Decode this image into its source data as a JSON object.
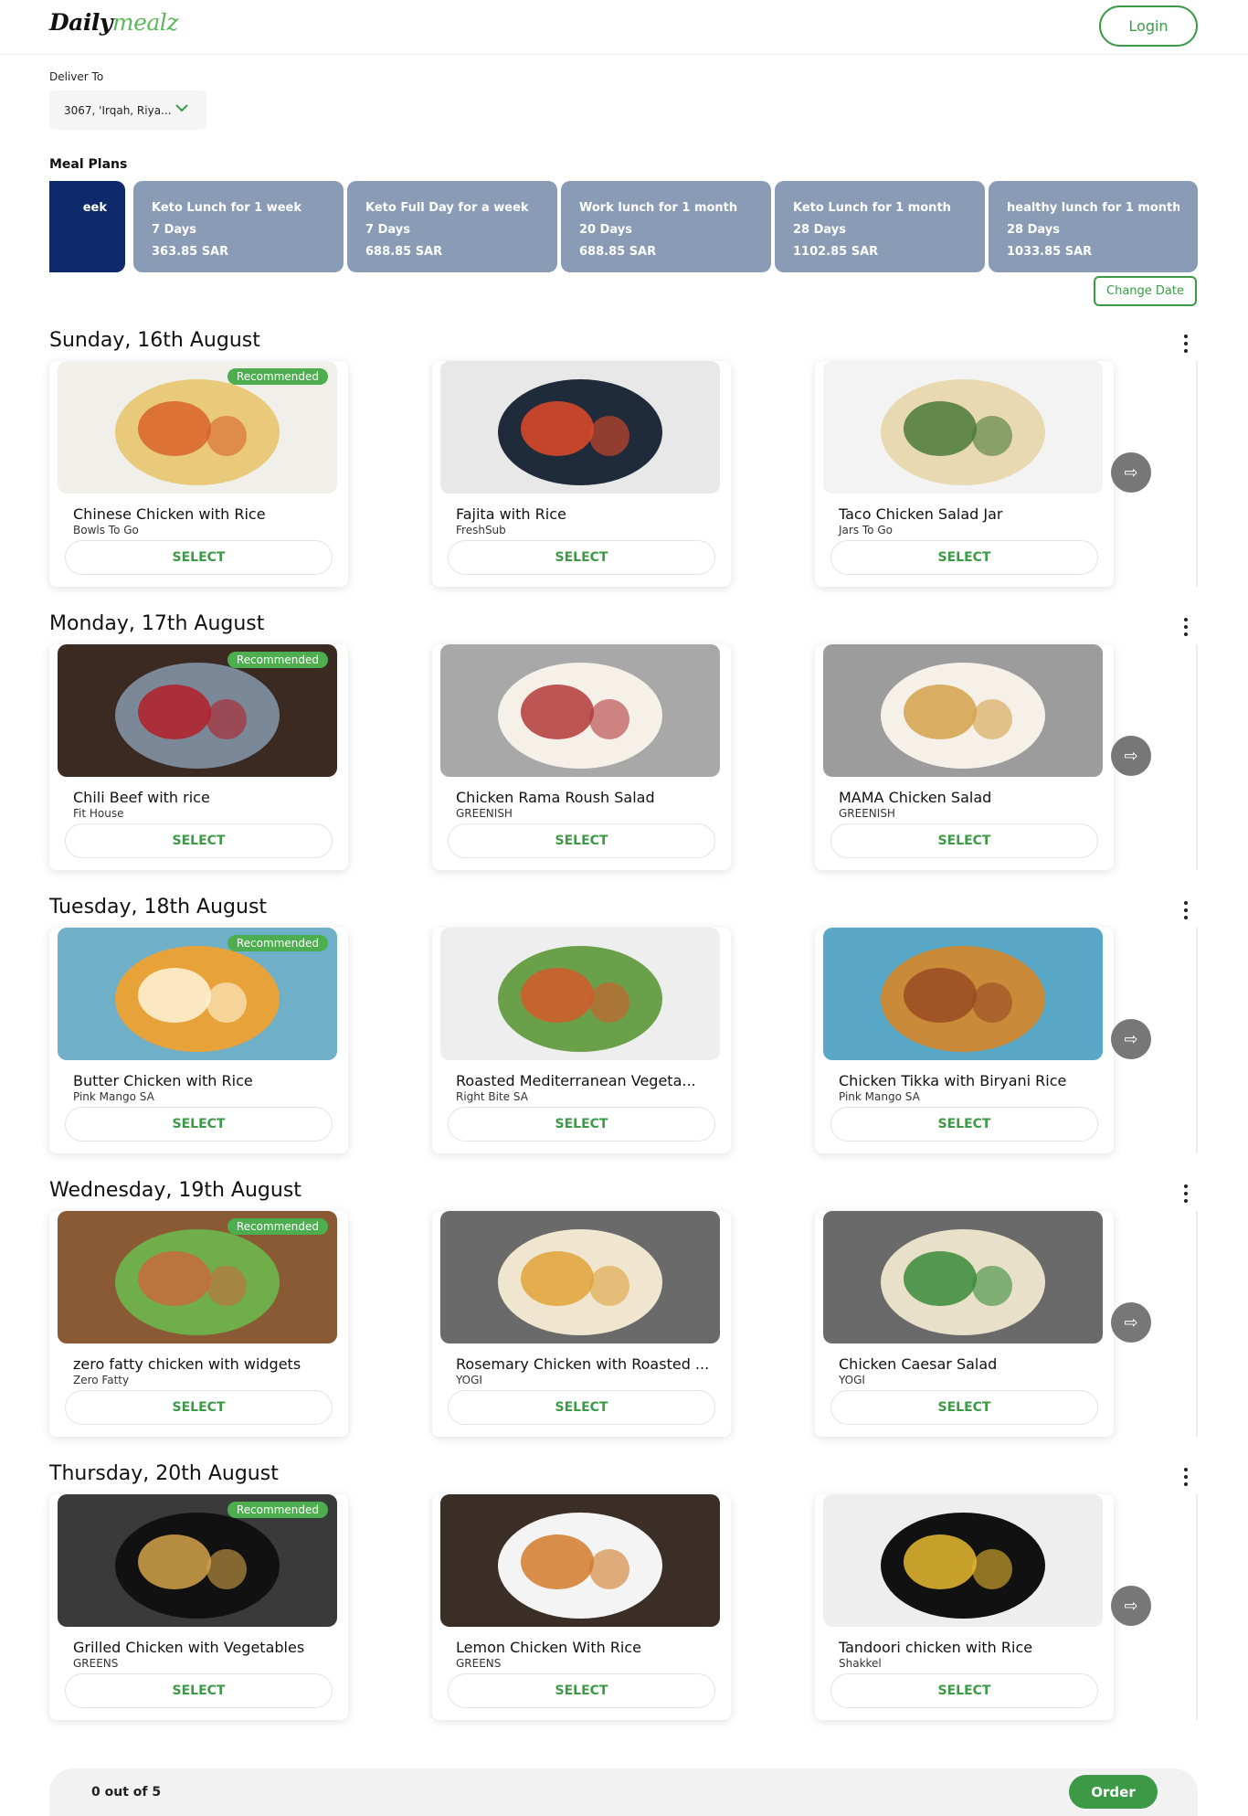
{
  "header": {
    "logo_main": "Daily",
    "logo_accent": "mealz",
    "login_label": "Login"
  },
  "deliver": {
    "label": "Deliver To",
    "value": "3067, 'Irqah, Riya..."
  },
  "meal_plans": {
    "label": "Meal Plans",
    "plans": [
      {
        "name": "eek",
        "days": "",
        "price": ""
      },
      {
        "name": "Keto Lunch for 1 week",
        "days": "7 Days",
        "price": "363.85 SAR"
      },
      {
        "name": "Keto Full Day for a week",
        "days": "7 Days",
        "price": "688.85 SAR"
      },
      {
        "name": "Work lunch for 1 month",
        "days": "20 Days",
        "price": "688.85 SAR"
      },
      {
        "name": "Keto Lunch for 1 month",
        "days": "28 Days",
        "price": "1102.85 SAR"
      },
      {
        "name": "healthy lunch for 1 month",
        "days": "28 Days",
        "price": "1033.85 SAR"
      }
    ],
    "change_date_label": "Change Date"
  },
  "days": [
    {
      "title": "Sunday, 16th August",
      "meals": [
        {
          "name": "Chinese Chicken with Rice",
          "brand": "Bowls To Go",
          "badge": "Recommended",
          "select": "SELECT"
        },
        {
          "name": "Fajita with Rice",
          "brand": "FreshSub",
          "badge": "",
          "select": "SELECT"
        },
        {
          "name": "Taco Chicken Salad Jar",
          "brand": "Jars To Go",
          "badge": "",
          "select": "SELECT"
        }
      ]
    },
    {
      "title": "Monday, 17th August",
      "meals": [
        {
          "name": "Chili Beef with rice",
          "brand": "Fit House",
          "badge": "Recommended",
          "select": "SELECT"
        },
        {
          "name": "Chicken Rama Roush Salad",
          "brand": "GREENISH",
          "badge": "",
          "select": "SELECT"
        },
        {
          "name": "MAMA Chicken Salad",
          "brand": "GREENISH",
          "badge": "",
          "select": "SELECT"
        }
      ]
    },
    {
      "title": "Tuesday, 18th August",
      "meals": [
        {
          "name": "Butter Chicken with Rice",
          "brand": "Pink Mango SA",
          "badge": "Recommended",
          "select": "SELECT"
        },
        {
          "name": "Roasted Mediterranean Vegeta...",
          "brand": "Right Bite SA",
          "badge": "",
          "select": "SELECT"
        },
        {
          "name": "Chicken Tikka with Biryani Rice",
          "brand": "Pink Mango SA",
          "badge": "",
          "select": "SELECT"
        }
      ]
    },
    {
      "title": "Wednesday, 19th August",
      "meals": [
        {
          "name": "zero fatty chicken with widgets",
          "brand": "Zero Fatty",
          "badge": "Recommended",
          "select": "SELECT"
        },
        {
          "name": "Rosemary Chicken with Roasted ...",
          "brand": "YOGI",
          "badge": "",
          "select": "SELECT"
        },
        {
          "name": "Chicken Caesar Salad",
          "brand": "YOGI",
          "badge": "",
          "select": "SELECT"
        }
      ]
    },
    {
      "title": "Thursday, 20th August",
      "meals": [
        {
          "name": "Grilled Chicken with Vegetables",
          "brand": "GREENS",
          "badge": "Recommended",
          "select": "SELECT"
        },
        {
          "name": "Lemon Chicken With Rice",
          "brand": "GREENS",
          "badge": "",
          "select": "SELECT"
        },
        {
          "name": "Tandoori chicken with Rice",
          "brand": "Shakkel",
          "badge": "",
          "select": "SELECT"
        }
      ]
    }
  ],
  "footer": {
    "count_text": "0 out of 5",
    "order_label": "Order"
  },
  "colors": {
    "accent_green": "#3c9a46",
    "plan_card": "#8a9bb5",
    "plan_card_active": "#0f2a6b"
  }
}
